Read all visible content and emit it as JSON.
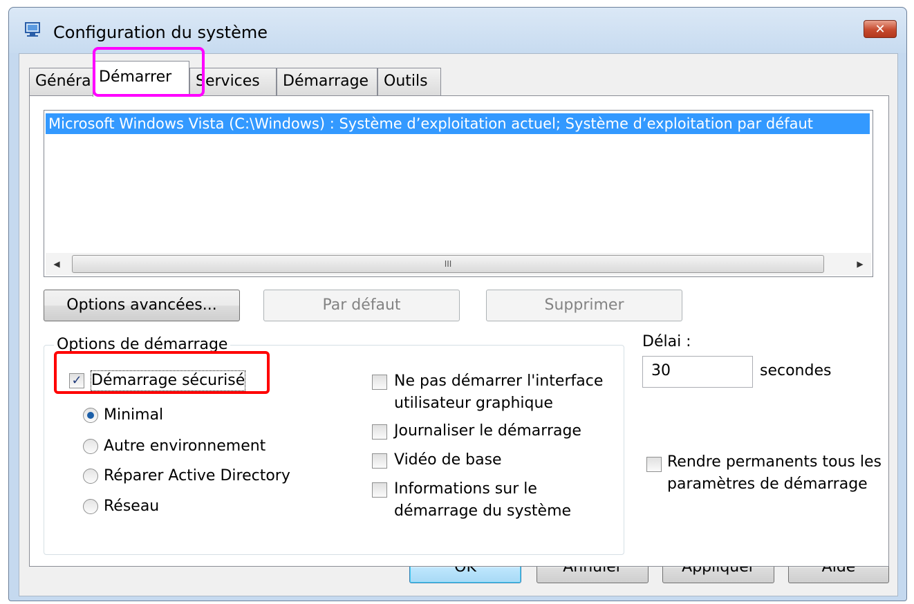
{
  "window": {
    "title": "Configuration du système",
    "close_label": "✕"
  },
  "tabs": [
    {
      "label": "Généra",
      "active": false
    },
    {
      "label": "Démarrer",
      "active": true
    },
    {
      "label": "Services",
      "active": false
    },
    {
      "label": "Démarrage",
      "active": false
    },
    {
      "label": "Outils",
      "active": false
    }
  ],
  "boot_list": {
    "items": [
      "Microsoft Windows Vista (C:\\Windows) : Système d’exploitation actuel; Système d’exploitation par défaut"
    ],
    "scroll_thumb_label": "III",
    "scroll_left": "◀",
    "scroll_right": "▶"
  },
  "action_buttons": {
    "advanced": "Options avancées...",
    "set_default": "Par défaut",
    "delete": "Supprimer"
  },
  "boot_options": {
    "legend": "Options de démarrage",
    "safe_boot": {
      "label": "Démarrage sécurisé",
      "checked": true
    },
    "radios": [
      {
        "label": "Minimal",
        "selected": true
      },
      {
        "label": "Autre environnement",
        "selected": false
      },
      {
        "label": "Réparer Active Directory",
        "selected": false
      },
      {
        "label": "Réseau",
        "selected": false
      }
    ],
    "checks": [
      {
        "label_line1": "Ne pas démarrer l'interface",
        "label_line2": "utilisateur graphique",
        "checked": false
      },
      {
        "label_line1": "Journaliser le démarrage",
        "label_line2": "",
        "checked": false
      },
      {
        "label_line1": "Vidéo de base",
        "label_line2": "",
        "checked": false
      },
      {
        "label_line1": "Informations sur le",
        "label_line2": "démarrage du système",
        "checked": false
      }
    ]
  },
  "timeout": {
    "label": "Délai :",
    "value": "30",
    "unit": "secondes"
  },
  "permanent": {
    "label_line1": "Rendre permanents tous les",
    "label_line2": "paramètres de démarrage",
    "checked": false
  },
  "footer_buttons": {
    "ok": "OK",
    "cancel": "Annuler",
    "apply": "Appliquer",
    "help": "Aide"
  },
  "colors": {
    "selection": "#3399ff",
    "highlight_tab": "#ff00ff",
    "highlight_safe_boot": "#ff0000"
  }
}
